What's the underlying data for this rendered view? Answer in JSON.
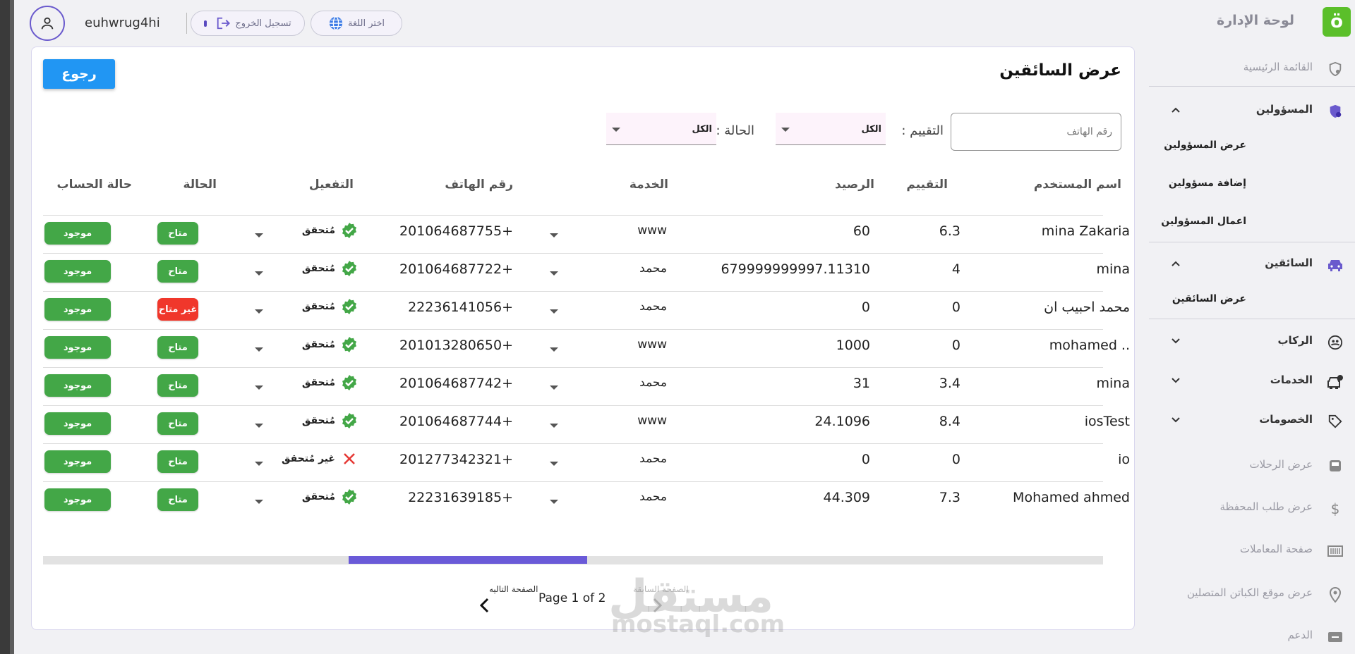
{
  "header": {
    "username": "euhwrug4hi",
    "logout_label": "تسجيل الخروج",
    "language_label": "اختر اللغة",
    "brand": "لوحة الإدارة",
    "logo_text": "ö"
  },
  "sidebar": {
    "home": "القائمة الرئيسية",
    "admins": "المسؤولين",
    "admins_sub": [
      "عرض المسؤولين",
      "إضافة مسؤولين",
      "اعمال المسؤولين"
    ],
    "drivers": "السائقين",
    "drivers_sub": [
      "عرض السائقين"
    ],
    "riders": "الركاب",
    "services": "الخدمات",
    "discounts": "الخصومات",
    "trips": "عرض الرحلات",
    "wallet": "عرض طلب المحفظة",
    "transactions": "صفحة المعاملات",
    "captains_location": "عرض  موقع الكباتن المتصلين",
    "support": "الدعم"
  },
  "page": {
    "title": "عرض السائقين",
    "back_label": "رجوع",
    "filters": {
      "phone_placeholder": "رقم الهاتف",
      "rating_label": "التقييم :",
      "rating_value": "الكل",
      "status_label": "الحالة :",
      "status_value": "الكل"
    },
    "columns": {
      "username": "اسم المستخدم",
      "rating": "التقييم",
      "balance": "الرصيد",
      "service": "الخدمة",
      "phone": "رقم الهاتف",
      "activation": "التفعيل",
      "status": "الحالة",
      "account_status": "حالة الحساب"
    },
    "rows": [
      {
        "username": "mina Zakaria",
        "rating": "6.3",
        "balance": "60",
        "service": "www",
        "phone": "201064687755+",
        "verified": true,
        "activation": "مُتحقق",
        "status": "متاح",
        "status_color": "#43a747",
        "account": "موجود"
      },
      {
        "username": "mina",
        "rating": "4",
        "balance": "679999999997.11310",
        "service": "محمد",
        "phone": "201064687722+",
        "verified": true,
        "activation": "مُتحقق",
        "status": "متاح",
        "status_color": "#43a747",
        "account": "موجود"
      },
      {
        "username": "محمد احبيب ان",
        "rating": "0",
        "balance": "0",
        "service": "محمد",
        "phone": "22236141056+",
        "verified": true,
        "activation": "مُتحقق",
        "status": "غير متاح",
        "status_color": "#f0372b",
        "account": "موجود"
      },
      {
        "username": "mohamed ..",
        "rating": "0",
        "balance": "1000",
        "service": "www",
        "phone": "201013280650+",
        "verified": true,
        "activation": "مُتحقق",
        "status": "متاح",
        "status_color": "#43a747",
        "account": "موجود"
      },
      {
        "username": "mina",
        "rating": "3.4",
        "balance": "31",
        "service": "محمد",
        "phone": "201064687742+",
        "verified": true,
        "activation": "مُتحقق",
        "status": "متاح",
        "status_color": "#43a747",
        "account": "موجود"
      },
      {
        "username": "iosTest",
        "rating": "8.4",
        "balance": "24.1096",
        "service": "www",
        "phone": "201064687744+",
        "verified": true,
        "activation": "مُتحقق",
        "status": "متاح",
        "status_color": "#43a747",
        "account": "موجود"
      },
      {
        "username": "io",
        "rating": "0",
        "balance": "0",
        "service": "محمد",
        "phone": "201277342321+",
        "verified": false,
        "activation": "غير مُتحقق",
        "status": "متاح",
        "status_color": "#43a747",
        "account": "موجود"
      },
      {
        "username": "Mohamed ahmed",
        "rating": "7.3",
        "balance": "44.309",
        "service": "محمد",
        "phone": "22231639185+",
        "verified": true,
        "activation": "مُتحقق",
        "status": "متاح",
        "status_color": "#43a747",
        "account": "موجود"
      }
    ],
    "pagination": {
      "text": "Page 1 of 2",
      "next_label": "الصفحة التاليه",
      "prev_label": "الصفحة السابقة"
    }
  },
  "watermark": {
    "ar": "مستقل",
    "en": "mostaql.com"
  }
}
